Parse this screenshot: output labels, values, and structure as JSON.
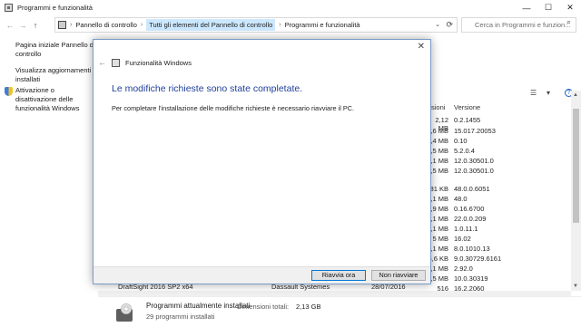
{
  "window": {
    "title": "Programmi e funzionalità",
    "minimize": "—",
    "maximize": "☐",
    "close": "✕"
  },
  "address": {
    "back": "←",
    "forward": "→",
    "up": "↑",
    "sep": "›",
    "crumbs": [
      "Pannello di controllo",
      "Tutti gli elementi del Pannello di controllo",
      "Programmi e funzionalità"
    ],
    "dropdown": "⌄",
    "refresh": "⟳",
    "search_placeholder": "Cerca in Programmi e funzion...",
    "search_icon": "⌕"
  },
  "sidebar": {
    "items": [
      {
        "label": "Pagina iniziale Pannello di controllo"
      },
      {
        "label": "Visualizza aggiornamenti installati"
      },
      {
        "label": "Attivazione o disattivazione delle funzionalità Windows"
      }
    ]
  },
  "list": {
    "view_icon": "☰",
    "view_dd": "▾",
    "help_icon": "?",
    "col_size_partial": "sioni",
    "col_version": "Versione",
    "rows": [
      {
        "size": "2,12 MB",
        "version": "0.2.1455"
      },
      {
        "size": "5,6 MB",
        "version": "15.017.20053"
      },
      {
        "size": "0,4 MB",
        "version": "0.10"
      },
      {
        "size": "0,5 MB",
        "version": "5.2.0.4"
      },
      {
        "size": "4,1 MB",
        "version": "12.0.30501.0"
      },
      {
        "size": "1,5 MB",
        "version": "12.0.30501.0"
      },
      {
        "size": "31 KB",
        "version": "48.0.0.6051"
      },
      {
        "size": "1,1 MB",
        "version": "48.0"
      },
      {
        "size": "0,9 MB",
        "version": "0.16.6700"
      },
      {
        "size": "1,1 MB",
        "version": "22.0.0.209"
      },
      {
        "size": "1,1 MB",
        "version": "1.0.11.1"
      },
      {
        "size": "5 MB",
        "version": "16.02"
      },
      {
        "size": "1,1 MB",
        "version": "8.0.1010.13"
      },
      {
        "size": "3,6 KB",
        "version": "9.0.30729.6161"
      },
      {
        "size": "1,1 MB",
        "version": "2.92.0"
      },
      {
        "size": "0,5 MB",
        "version": "10.0.30319"
      },
      {
        "size": "516 MB",
        "version": "16.2.2060"
      }
    ],
    "partial_row_1": "DraftSight 2016 SP2 x64",
    "partial_row_1_pub": "Dassault Systemes",
    "partial_row_1_date": "28/07/2016"
  },
  "status": {
    "title": "Programmi attualmente installati",
    "size_label": "Dimensioni totali:",
    "size_value": "2,13 GB",
    "count": "29 programmi installati"
  },
  "dialog": {
    "close": "✕",
    "back": "←",
    "title": "Funzionalità Windows",
    "heading": "Le modifiche richieste sono state completate.",
    "text": "Per completare l'installazione delle modifiche richieste è necessario riavviare il PC.",
    "restart_label": "Riavvia ora",
    "no_restart_label": "Non riavviare"
  }
}
